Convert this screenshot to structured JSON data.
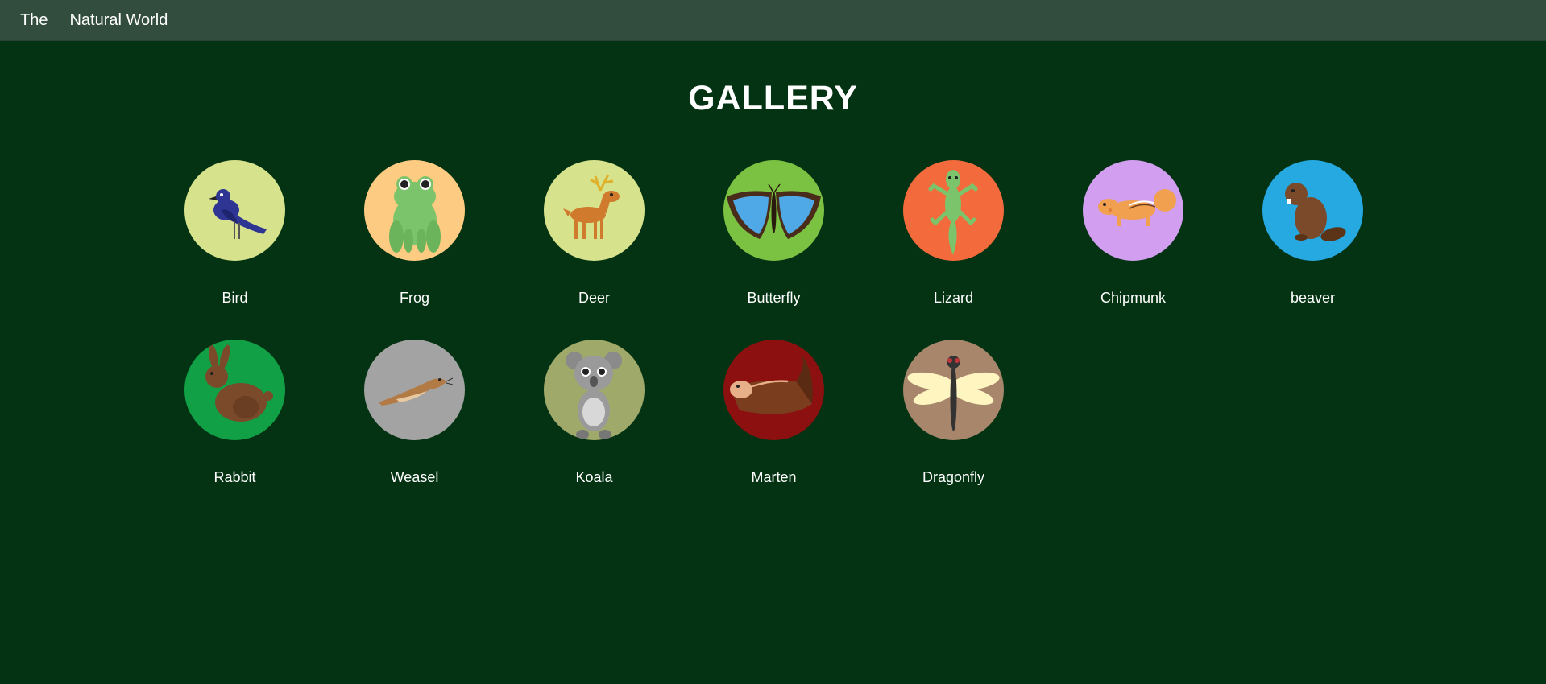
{
  "nav": {
    "brand_first": "The",
    "brand_second": "Natural World"
  },
  "page": {
    "title": "GALLERY"
  },
  "colors": {
    "background": "#043313",
    "topbar": "#324d3e"
  },
  "gallery": [
    {
      "label": "Bird",
      "icon": "bird-icon",
      "circle_color": "#d6e38c"
    },
    {
      "label": "Frog",
      "icon": "frog-icon",
      "circle_color": "#fecb82"
    },
    {
      "label": "Deer",
      "icon": "deer-icon",
      "circle_color": "#d6e38c"
    },
    {
      "label": "Butterfly",
      "icon": "butterfly-icon",
      "circle_color": "#7cc242"
    },
    {
      "label": "Lizard",
      "icon": "lizard-icon",
      "circle_color": "#f36b3c"
    },
    {
      "label": "Chipmunk",
      "icon": "chipmunk-icon",
      "circle_color": "#d29ff0"
    },
    {
      "label": "beaver",
      "icon": "beaver-icon",
      "circle_color": "#26a8e0"
    },
    {
      "label": "Rabbit",
      "icon": "rabbit-icon",
      "circle_color": "#11a046"
    },
    {
      "label": "Weasel",
      "icon": "weasel-icon",
      "circle_color": "#a3a3a3"
    },
    {
      "label": "Koala",
      "icon": "koala-icon",
      "circle_color": "#9fa96a"
    },
    {
      "label": "Marten",
      "icon": "marten-icon",
      "circle_color": "#8c1010"
    },
    {
      "label": "Dragonfly",
      "icon": "dragonfly-icon",
      "circle_color": "#a7866b"
    }
  ]
}
